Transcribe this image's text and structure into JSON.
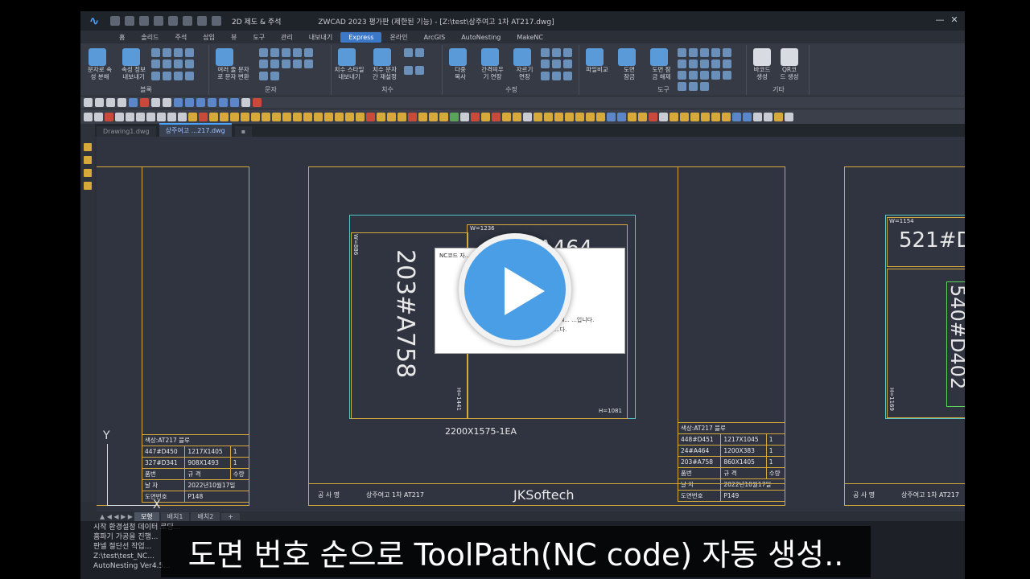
{
  "titlebar": {
    "workspace": "2D 제도 & 주석",
    "title": "ZWCAD 2023 평가판 (제한된 기능) - [Z:\\test\\상주여고 1차 AT217.dwg]"
  },
  "menu": {
    "tabs": [
      "홈",
      "솔리드",
      "주석",
      "삽입",
      "뷰",
      "도구",
      "관리",
      "내보내기",
      "Express",
      "온라인",
      "ArcGIS",
      "AutoNesting",
      "MakeNC"
    ],
    "active": "Express"
  },
  "ribbon": {
    "groups": [
      {
        "label": "블록",
        "buttons": [
          "문자로 속\n성 분해",
          "속성 정보\n내보내기"
        ]
      },
      {
        "label": "문자",
        "buttons": [
          "여러 줄 문자\n로 문자 변환"
        ]
      },
      {
        "label": "치수",
        "buttons": [
          "치수 스타일\n내보내기",
          "치수 문자\n간 재설정"
        ]
      },
      {
        "label": "수정",
        "buttons": [
          "다중\n복사",
          "간격띄우\n기 연장",
          "자르기\n연장"
        ]
      },
      {
        "label": "도구",
        "buttons": [
          "파일비교",
          "도면\n잠금",
          "도면 잠\n금 해제"
        ]
      },
      {
        "label": "기타",
        "buttons": [
          "바코드\n생성",
          "QR코\n드 생성"
        ]
      }
    ]
  },
  "doc_tabs": [
    "Drawing1.dwg",
    "상주여고 ...217.dwg"
  ],
  "canvas": {
    "left_sheet": {
      "table_header": "색상:AT217 블루",
      "rows": [
        [
          "447#D450",
          "1217X1405",
          "1"
        ],
        [
          "327#D341",
          "908X1493",
          "1"
        ]
      ],
      "cols": [
        "품번",
        "규  격",
        "수량"
      ],
      "date_label": "날   자",
      "date": "2022년10월17일",
      "no_label": "도면번호",
      "no": "P148"
    },
    "center_sheet": {
      "part1_label": "203#A758",
      "part1_w": "W=886",
      "part1_h": "H=1441",
      "part2_label": "24#A464",
      "part2_w": "W=1236",
      "part2_h": "H=1081",
      "sheet_size": "2200X1575-1EA",
      "company_label": "공 사 명",
      "company": "상주여고 1차 AT217",
      "brand": "JKSoftech",
      "table_header": "색상:AT217 블루",
      "rows": [
        [
          "448#D451",
          "1217X1045",
          "1"
        ],
        [
          "24#A464",
          "1200X383",
          "1"
        ],
        [
          "203#A758",
          "860X1405",
          "1"
        ]
      ],
      "cols": [
        "품번",
        "규  격",
        "수량"
      ],
      "date_label": "날   자",
      "date": "2022년10월17일",
      "no_label": "도면번호",
      "no": "P149"
    },
    "right_sheet": {
      "part1_label": "521#D",
      "part1_w": "W=1154",
      "part2_label": "540#D402",
      "part2_h": "H=1169",
      "company_label": "공 사 명",
      "company": "상주여고 1차 AT217"
    }
  },
  "model_tabs": [
    "모형",
    "배치1",
    "배치2",
    "+"
  ],
  "command_lines": [
    "시작 환경설정 데이터 로딩...",
    "홈파기 가공을 진행...",
    "판넬 절단선 작업...",
    "Z:\\test\\test_NC...",
    "AutoNesting Ver4.5..."
  ],
  "dialog": {
    "title": "NC코드 자...",
    "message1": "N...  ...입니다.",
    "message2": "...다."
  },
  "caption": "도면 번호 순으로 ToolPath(NC code) 자동 생성.."
}
